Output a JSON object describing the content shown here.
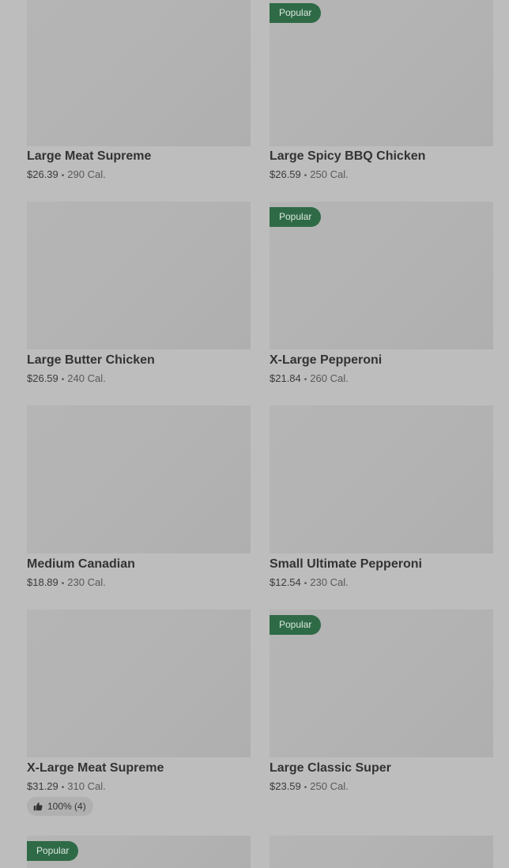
{
  "items": [
    {
      "name": "Large Meat Supreme",
      "price": "$26.39",
      "calories": "290 Cal.",
      "badge": ""
    },
    {
      "name": "Large Spicy BBQ Chicken",
      "price": "$26.59",
      "calories": "250 Cal.",
      "badge": "Popular"
    },
    {
      "name": "Large Butter Chicken",
      "price": "$26.59",
      "calories": "240 Cal.",
      "badge": ""
    },
    {
      "name": "X-Large Pepperoni",
      "price": "$21.84",
      "calories": "260 Cal.",
      "badge": "Popular"
    },
    {
      "name": "Medium Canadian",
      "price": "$18.89",
      "calories": "230 Cal.",
      "badge": ""
    },
    {
      "name": "Small Ultimate Pepperoni",
      "price": "$12.54",
      "calories": "230 Cal.",
      "badge": ""
    },
    {
      "name": "X-Large Meat Supreme",
      "price": "$31.29",
      "calories": "310 Cal.",
      "badge": "",
      "rating": "100% (4)"
    },
    {
      "name": "Large Classic Super",
      "price": "$23.59",
      "calories": "250 Cal.",
      "badge": "Popular"
    },
    {
      "name": "",
      "price": "",
      "calories": "",
      "badge": "Popular"
    },
    {
      "name": "",
      "price": "",
      "calories": "",
      "badge": ""
    }
  ],
  "separator": "•",
  "icons": {
    "rating": "thumbs-up-icon"
  },
  "colors": {
    "badge_bg": "#2f6a47",
    "badge_text": "#dce8e0",
    "page_bg": "#bdbdbd"
  }
}
